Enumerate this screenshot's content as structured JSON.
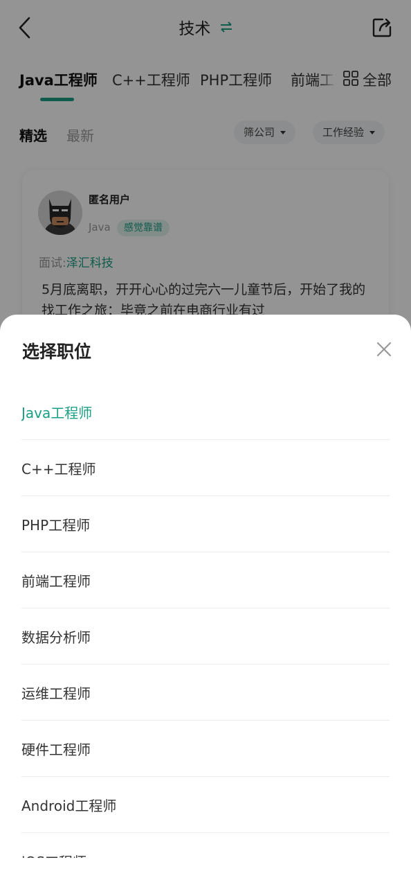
{
  "header": {
    "title": "技术"
  },
  "tabs": {
    "items": [
      "Java工程师",
      "C++工程师",
      "PHP工程师",
      "前端工程师"
    ],
    "all_label": "全部"
  },
  "filters": {
    "featured": "精选",
    "latest": "最新",
    "company_chip": "筛公司",
    "experience_chip": "工作经验"
  },
  "card": {
    "username": "匿名用户",
    "role": "Java",
    "badge": "感觉靠谱",
    "interview_prefix": "面试:",
    "company": "泽汇科技",
    "text": "5月底离职，开开心心的过完六一儿童节后，开始了我的找工作之旅：毕竟之前在电商行业有过"
  },
  "sheet": {
    "title": "选择职位",
    "items": [
      {
        "label": "Java工程师",
        "selected": true
      },
      {
        "label": "C++工程师",
        "selected": false
      },
      {
        "label": "PHP工程师",
        "selected": false
      },
      {
        "label": "前端工程师",
        "selected": false
      },
      {
        "label": "数据分析师",
        "selected": false
      },
      {
        "label": "运维工程师",
        "selected": false
      },
      {
        "label": "硬件工程师",
        "selected": false
      },
      {
        "label": "Android工程师",
        "selected": false
      },
      {
        "label": "iOS工程师",
        "selected": false
      }
    ]
  },
  "colors": {
    "accent": "#1a9e84",
    "overlay": "rgba(0,0,0,0.42)"
  },
  "icons": {
    "back": "back-arrow-icon",
    "switch": "switch-arrows-icon",
    "share": "share-icon",
    "all": "grid-icon",
    "close": "close-icon"
  }
}
